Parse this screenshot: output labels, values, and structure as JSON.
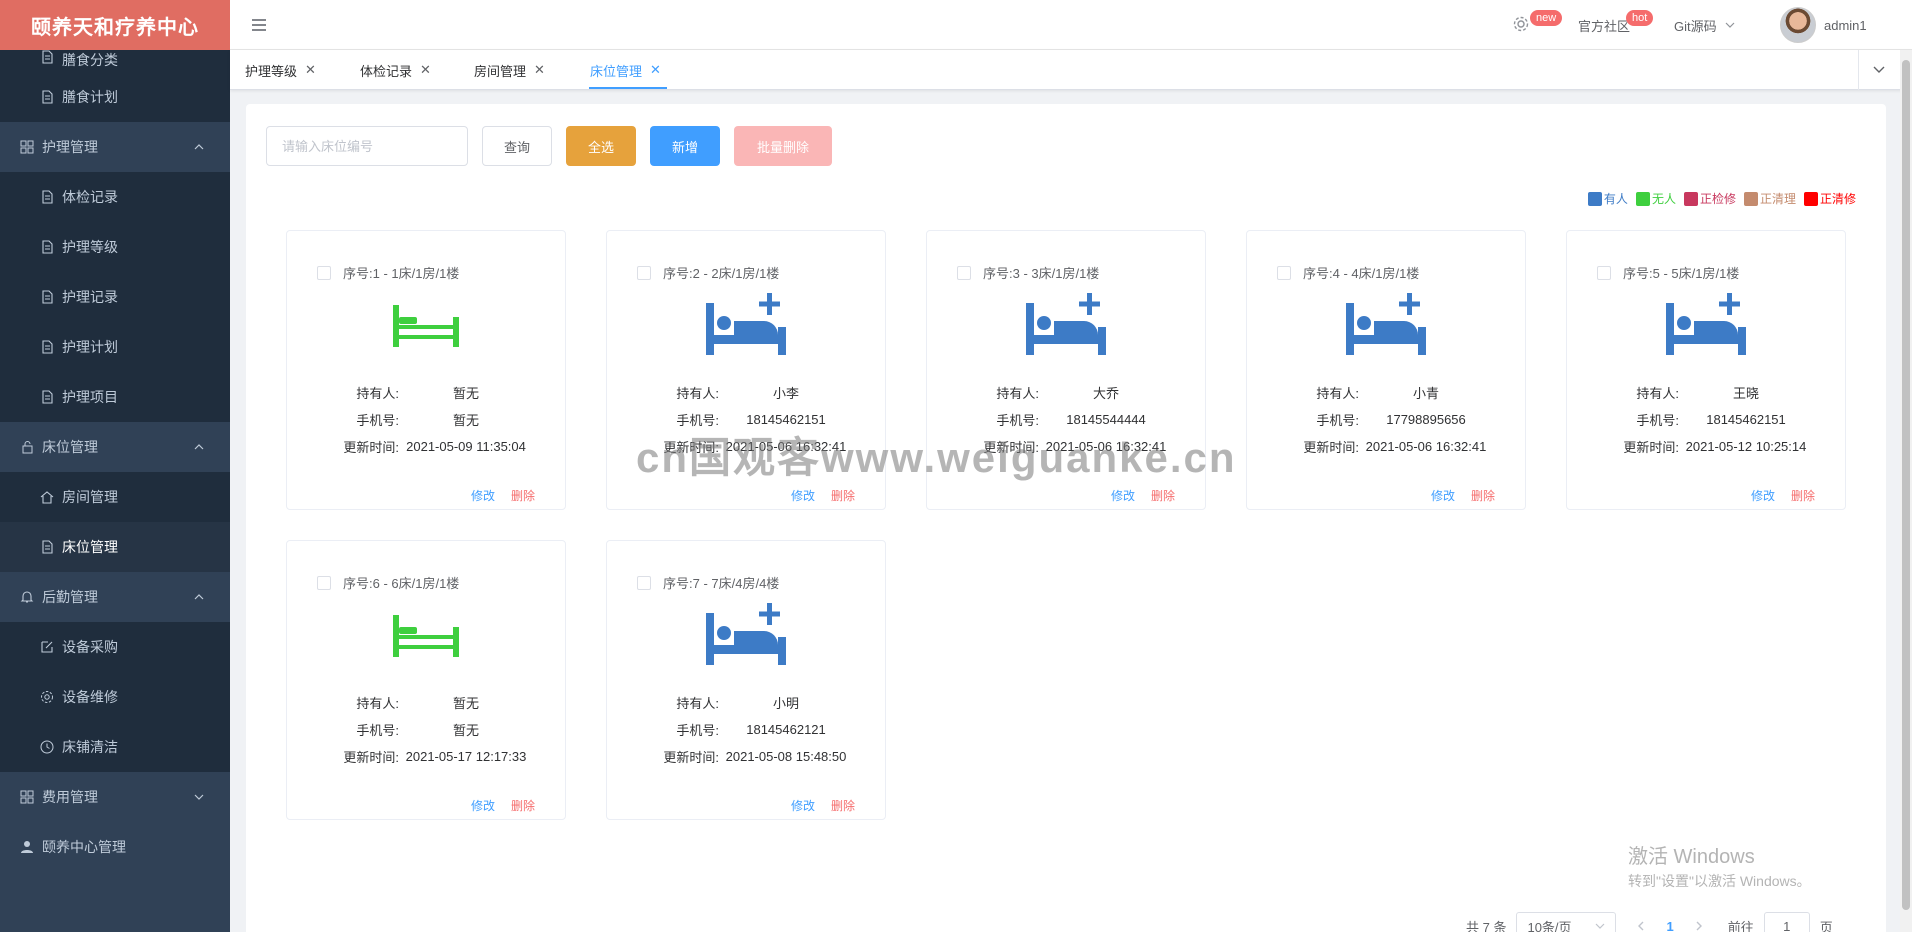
{
  "app": {
    "title": "颐养天和疗养中心"
  },
  "sidebar": {
    "items": [
      {
        "label": "膳食分类",
        "level": 2,
        "icon": "document-icon"
      },
      {
        "label": "膳食计划",
        "level": 2,
        "icon": "document-icon"
      },
      {
        "label": "护理管理",
        "level": 1,
        "icon": "grid-icon",
        "expanded": true
      },
      {
        "label": "体检记录",
        "level": 2,
        "icon": "document-icon"
      },
      {
        "label": "护理等级",
        "level": 2,
        "icon": "document-icon"
      },
      {
        "label": "护理记录",
        "level": 2,
        "icon": "document-icon"
      },
      {
        "label": "护理计划",
        "level": 2,
        "icon": "document-icon"
      },
      {
        "label": "护理项目",
        "level": 2,
        "icon": "document-icon"
      },
      {
        "label": "床位管理",
        "level": 1,
        "icon": "lock-icon",
        "expanded": true
      },
      {
        "label": "房间管理",
        "level": 2,
        "icon": "home-icon"
      },
      {
        "label": "床位管理",
        "level": 2,
        "icon": "document-icon",
        "active": true
      },
      {
        "label": "后勤管理",
        "level": 1,
        "icon": "bell-icon",
        "expanded": true
      },
      {
        "label": "设备采购",
        "level": 2,
        "icon": "edit-icon"
      },
      {
        "label": "设备维修",
        "level": 2,
        "icon": "gear-icon"
      },
      {
        "label": "床铺清洁",
        "level": 2,
        "icon": "clock-icon"
      },
      {
        "label": "费用管理",
        "level": 1,
        "icon": "grid-icon",
        "expanded": false
      },
      {
        "label": "颐养中心管理",
        "level": 1,
        "icon": "user-icon"
      }
    ]
  },
  "header": {
    "new_badge": "new",
    "community": "官方社区",
    "hot_badge": "hot",
    "git": "Git源码",
    "user": "admin1"
  },
  "tags": [
    {
      "label": "护理等级"
    },
    {
      "label": "体检记录"
    },
    {
      "label": "房间管理"
    },
    {
      "label": "床位管理",
      "active": true
    }
  ],
  "toolbar": {
    "search_placeholder": "请输入床位编号",
    "query": "查询",
    "select_all": "全选",
    "add": "新增",
    "batch_delete": "批量删除"
  },
  "legend": [
    {
      "label": "有人",
      "color": "#3d7bc6"
    },
    {
      "label": "无人",
      "color": "#3ecf3e"
    },
    {
      "label": "正检修",
      "color": "#c8385e"
    },
    {
      "label": "正清理",
      "color": "#c48b6e"
    },
    {
      "label": "正清修",
      "color": "#ff0000"
    }
  ],
  "labels": {
    "holder": "持有人:",
    "phone": "手机号:",
    "updated": "更新时间:",
    "edit": "修改",
    "delete": "删除"
  },
  "beds": [
    {
      "title": "序号:1 - 1床/1房/1楼",
      "status": "empty",
      "holder": "暂无",
      "phone": "暂无",
      "time": "2021-05-09 11:35:04"
    },
    {
      "title": "序号:2 - 2床/1房/1楼",
      "status": "occupied",
      "holder": "小李",
      "phone": "18145462151",
      "time": "2021-05-06 16:32:41"
    },
    {
      "title": "序号:3 - 3床/1房/1楼",
      "status": "occupied",
      "holder": "大乔",
      "phone": "18145544444",
      "time": "2021-05-06 16:32:41"
    },
    {
      "title": "序号:4 - 4床/1房/1楼",
      "status": "occupied",
      "holder": "小青",
      "phone": "17798895656",
      "time": "2021-05-06 16:32:41"
    },
    {
      "title": "序号:5 - 5床/1房/1楼",
      "status": "occupied",
      "holder": "王晓",
      "phone": "18145462151",
      "time": "2021-05-12 10:25:14"
    },
    {
      "title": "序号:6 - 6床/1房/1楼",
      "status": "empty",
      "holder": "暂无",
      "phone": "暂无",
      "time": "2021-05-17 12:17:33"
    },
    {
      "title": "序号:7 - 7床/4房/4楼",
      "status": "occupied",
      "holder": "小明",
      "phone": "18145462121",
      "time": "2021-05-08 15:48:50"
    }
  ],
  "watermark": "cn国观客www.weiguanke.cn",
  "windows": {
    "line1": "激活 Windows",
    "line2": "转到\"设置\"以激活 Windows。"
  },
  "pagination": {
    "total": "共 7 条",
    "page_size": "10条/页",
    "current": "1",
    "goto": "前往",
    "goto_value": "1",
    "page_unit": "页"
  }
}
